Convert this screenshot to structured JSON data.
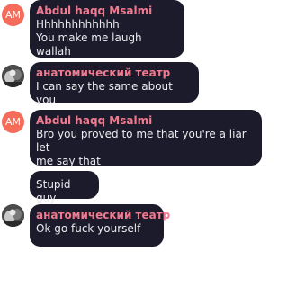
{
  "messages": [
    {
      "avatar": "AM",
      "sender": "Abdul haqq Msalmi",
      "lines": [
        "Hhhhhhhhhhhh",
        "You make me laugh wallah"
      ]
    },
    {
      "avatar_icon": "user-photo-icon",
      "sender": "анатомический театр",
      "lines": [
        "I can say the same about you"
      ]
    },
    {
      "avatar": "AM",
      "sender": "Abdul haqq Msalmi",
      "lines": [
        "Bro you proved to me that you're a liar let",
        "me say that"
      ]
    },
    {
      "lines": [
        "Stupid guy"
      ]
    },
    {
      "avatar_icon": "user-photo-icon",
      "sender": "анатомический театр",
      "lines": [
        "Ok go fuck yourself"
      ]
    }
  ],
  "colors": {
    "bubble_bg": "#1c1b2b",
    "sender_name": "#f07a8f",
    "message_text": "#ebebf0",
    "initials_avatar_bg": "#f56c5b"
  }
}
